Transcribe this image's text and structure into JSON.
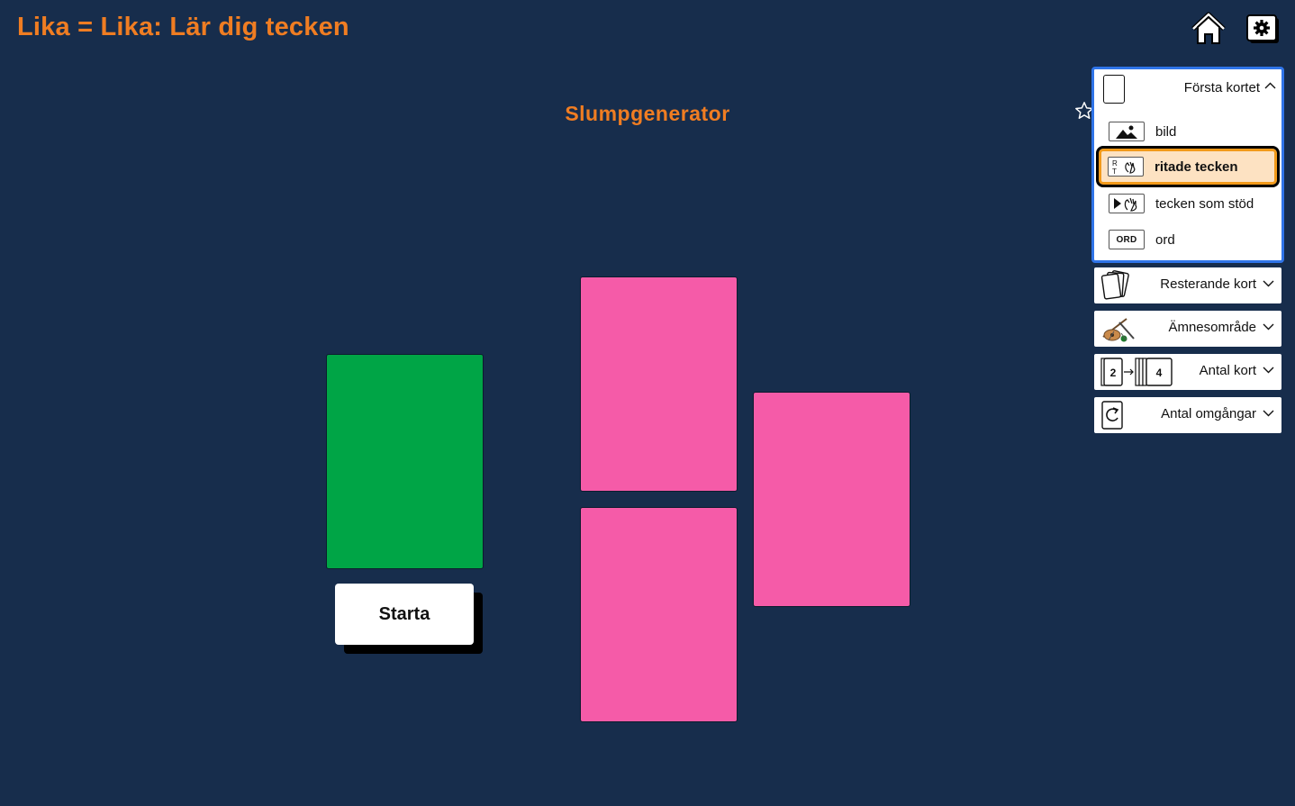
{
  "app": {
    "title": "Lika = Lika: Lär dig tecken"
  },
  "page": {
    "heading": "Slumpgenerator"
  },
  "top_icons": {
    "home": "home-icon",
    "settings": "gear-icon"
  },
  "start_button": {
    "label": "Starta"
  },
  "colors": {
    "background": "#172d4c",
    "accent": "#f07d22",
    "card_green": "#00a546",
    "card_pink": "#f55ba8",
    "panel_border": "#2f74e8",
    "selected_fill": "#fde2c2",
    "selected_border": "#f29a1a"
  },
  "first_card_panel": {
    "label": "Första kortet",
    "expanded": true,
    "selected": "ritade tecken",
    "options": [
      {
        "label": "bild",
        "icon": "image-icon"
      },
      {
        "label": "ritade tecken",
        "icon": "drawn-sign-icon"
      },
      {
        "label": "tecken som stöd",
        "icon": "sign-support-icon"
      },
      {
        "label": "ord",
        "icon": "word-icon",
        "icon_text": "ORD"
      }
    ]
  },
  "settings_sections": [
    {
      "label": "Resterande kort",
      "icon": "card-stack-icon"
    },
    {
      "label": "Ämnesområde",
      "icon": "instruments-icon"
    },
    {
      "label": "Antal kort",
      "icon": "card-count-icon",
      "icon_numbers": [
        "2",
        "4"
      ]
    },
    {
      "label": "Antal omgångar",
      "icon": "rounds-icon"
    }
  ]
}
